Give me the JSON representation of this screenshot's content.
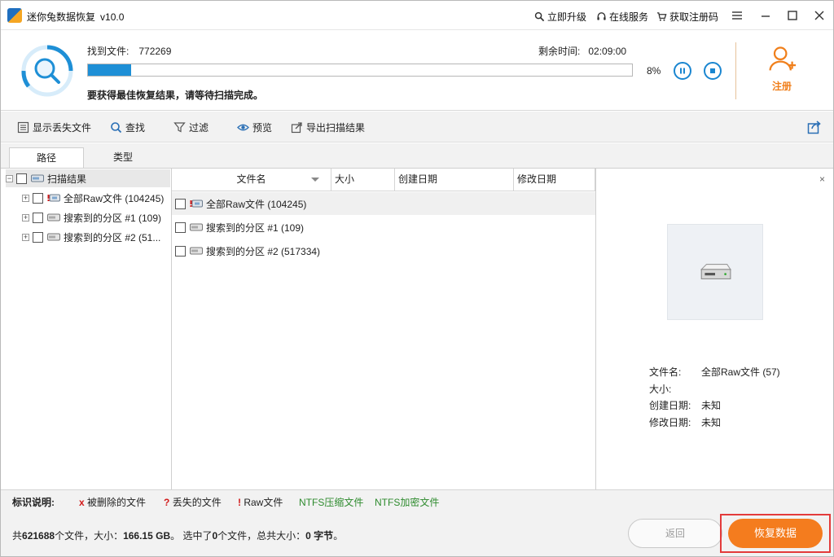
{
  "colors": {
    "accent_blue": "#1e8fd6",
    "accent_orange": "#f47c1e",
    "highlight_red": "#e33b3b",
    "legend_red": "#d21a1a",
    "legend_green": "#2e8b2e"
  },
  "window": {
    "app_name": "迷你兔数据恢复",
    "version": "v10.0",
    "links": {
      "upgrade": "立即升级",
      "online_service": "在线服务",
      "get_code": "获取注册码"
    }
  },
  "scan": {
    "found_label": "找到文件:",
    "found_count": "772269",
    "remaining_label": "剩余时间:",
    "remaining_value": "02:09:00",
    "progress_percent": 8,
    "percent_text": "8%",
    "notice": "要获得最佳恢复结果，请等待扫描完成。",
    "register_label": "注册"
  },
  "toolbar": {
    "show_lost": "显示丢失文件",
    "find": "查找",
    "filter": "过滤",
    "preview": "预览",
    "export": "导出扫描结果"
  },
  "tabs": {
    "path": "路径",
    "type": "类型"
  },
  "tree": {
    "root": "扫描结果",
    "items": [
      {
        "label": "全部Raw文件 (104245)",
        "icon": "raw-drive-icon"
      },
      {
        "label": "搜索到的分区 #1 (109)",
        "icon": "drive-icon"
      },
      {
        "label": "搜索到的分区 #2 (51...",
        "icon": "drive-icon"
      }
    ]
  },
  "columns": {
    "name": "文件名",
    "size": "大小",
    "created": "创建日期",
    "modified": "修改日期"
  },
  "files": [
    {
      "name": "全部Raw文件 (104245)",
      "icon": "raw-drive-icon"
    },
    {
      "name": "搜索到的分区 #1 (109)",
      "icon": "drive-icon"
    },
    {
      "name": "搜索到的分区 #2 (517334)",
      "icon": "drive-icon"
    }
  ],
  "preview": {
    "close": "×",
    "filename_label": "文件名:",
    "filename_value": "全部Raw文件 (57)",
    "size_label": "大小:",
    "size_value": "",
    "created_label": "创建日期:",
    "created_value": "未知",
    "modified_label": "修改日期:",
    "modified_value": "未知"
  },
  "legend": {
    "title": "标识说明:",
    "deleted_mark": "x",
    "deleted": "被删除的文件",
    "lost_mark": "?",
    "lost": "丢失的文件",
    "raw_mark": "!",
    "raw": "Raw文件",
    "ntfs_compressed": "NTFS压缩文件",
    "ntfs_encrypted": "NTFS加密文件"
  },
  "status": {
    "prefix": "共",
    "total_files": "621688",
    "files_unit": "个文件，大小：",
    "total_size": "166.15 GB",
    "selected_prefix": "。 选中了",
    "selected_count": "0",
    "selected_mid": "个文件，总共大小：",
    "selected_size": "0 字节",
    "end": "。"
  },
  "buttons": {
    "back": "返回",
    "recover": "恢复数据"
  }
}
